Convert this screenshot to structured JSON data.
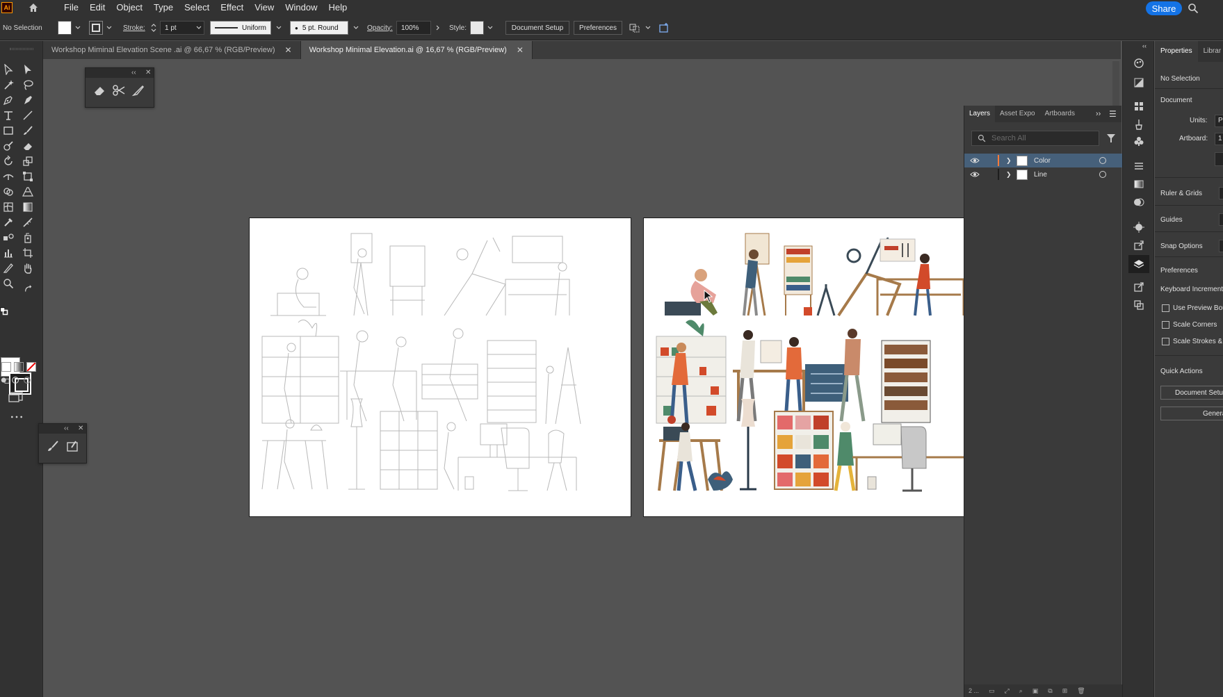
{
  "menubar": {
    "logo": "Ai",
    "items": [
      "File",
      "Edit",
      "Object",
      "Type",
      "Select",
      "Effect",
      "View",
      "Window",
      "Help"
    ],
    "share_label": "Share"
  },
  "controlbar": {
    "selection": "No Selection",
    "stroke_label": "Stroke:",
    "stroke_weight": "1 pt",
    "profile": "Uniform",
    "brush": "5 pt. Round",
    "opacity_label": "Opacity:",
    "opacity": "100%",
    "style_label": "Style:",
    "document_setup": "Document Setup",
    "preferences": "Preferences"
  },
  "tabs": [
    {
      "label": "Workshop Miminal Elevation Scene .ai @ 66,67 % (RGB/Preview)",
      "active": false
    },
    {
      "label": "Workshop Minimal Elevation.ai @ 16,67 % (RGB/Preview)",
      "active": true
    }
  ],
  "layers_panel": {
    "tabs": [
      "Layers",
      "Asset Expo",
      "Artboards"
    ],
    "search_placeholder": "Search All",
    "layers": [
      {
        "name": "Color",
        "color": "#ff7b3a",
        "selected": true
      },
      {
        "name": "Line",
        "color": "#1e1e1e",
        "selected": false
      }
    ],
    "footer_count": "2 ..."
  },
  "properties": {
    "tabs": [
      "Properties",
      "Librar"
    ],
    "selection": "No Selection",
    "document_title": "Document",
    "units_label": "Units:",
    "units_value": "Pi",
    "artboard_label": "Artboard:",
    "artboard_value": "1",
    "ruler_grids": "Ruler & Grids",
    "guides": "Guides",
    "snap_options": "Snap Options",
    "preferences": "Preferences",
    "keyboard_increment": "Keyboard Increment",
    "checks": [
      "Use Preview Bou",
      "Scale Corners",
      "Scale Strokes &"
    ],
    "quick_actions": "Quick Actions",
    "document_setup_btn": "Document Setu",
    "generate_btn": "Genera"
  },
  "colors": {
    "ui_dark": "#323232",
    "ui_mid": "#3a3a3a",
    "canvas": "#535353",
    "accent_blue": "#1473e6",
    "selection_row": "#46607a"
  }
}
